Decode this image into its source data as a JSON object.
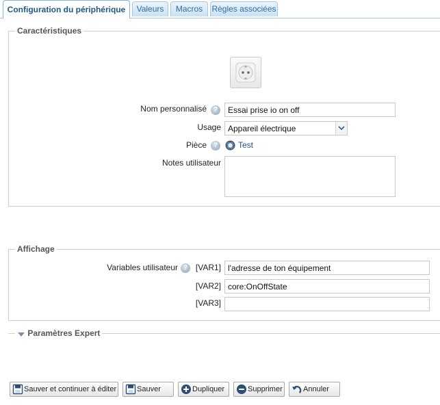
{
  "tabs": [
    {
      "label": "Configuration du périphérique",
      "active": true
    },
    {
      "label": "Valeurs",
      "active": false
    },
    {
      "label": "Macros",
      "active": false
    },
    {
      "label": "Règles associées",
      "active": false
    }
  ],
  "caracteristiques": {
    "legend": "Caractéristiques",
    "device_icon": "power-socket-icon",
    "name_label": "Nom personnalisé",
    "name_value": "Essai prise io on off",
    "usage_label": "Usage",
    "usage_value": "Appareil électrique",
    "piece_label": "Pièce",
    "piece_value": "Test",
    "notes_label": "Notes utilisateur",
    "notes_value": ""
  },
  "affichage": {
    "legend": "Affichage",
    "vars_label": "Variables utilisateur",
    "var1_label": "[VAR1]",
    "var1_value": "l'adresse de ton équipement",
    "var2_label": "[VAR2]",
    "var2_value": "core:OnOffState",
    "var3_label": "[VAR3]",
    "var3_value": ""
  },
  "expert": {
    "legend": "Paramètres Expert",
    "expanded": false
  },
  "buttons": {
    "save_continue": "Sauver et continuer à éditer",
    "save": "Sauver",
    "duplicate": "Dupliquer",
    "delete": "Supprimer",
    "cancel": "Annuler"
  },
  "colors": {
    "tab_active_text": "#1d5987",
    "tab_text": "#2e6e9e",
    "link": "#1f4f8f"
  }
}
